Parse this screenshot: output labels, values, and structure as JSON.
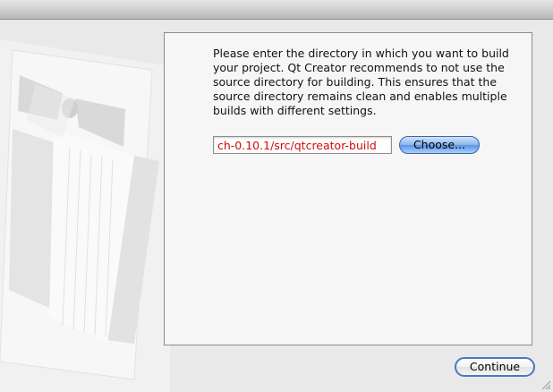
{
  "window": {
    "title": ""
  },
  "main": {
    "description": "Please enter the directory in which you want to build your project. Qt Creator recommends to not use the source directory for building. This ensures that the source directory remains clean and enables multiple builds with different settings.",
    "build_directory_value": "ch-0.10.1/src/qtcreator-build",
    "choose_label": "Choose..."
  },
  "footer": {
    "continue_label": "Continue"
  },
  "colors": {
    "path_text": "#d20a0a",
    "default_button_blue": "#5e93e3"
  },
  "icons": {
    "watermark": "qt-creator-tuxedo-watermark",
    "resize": "resize-grip-icon"
  }
}
